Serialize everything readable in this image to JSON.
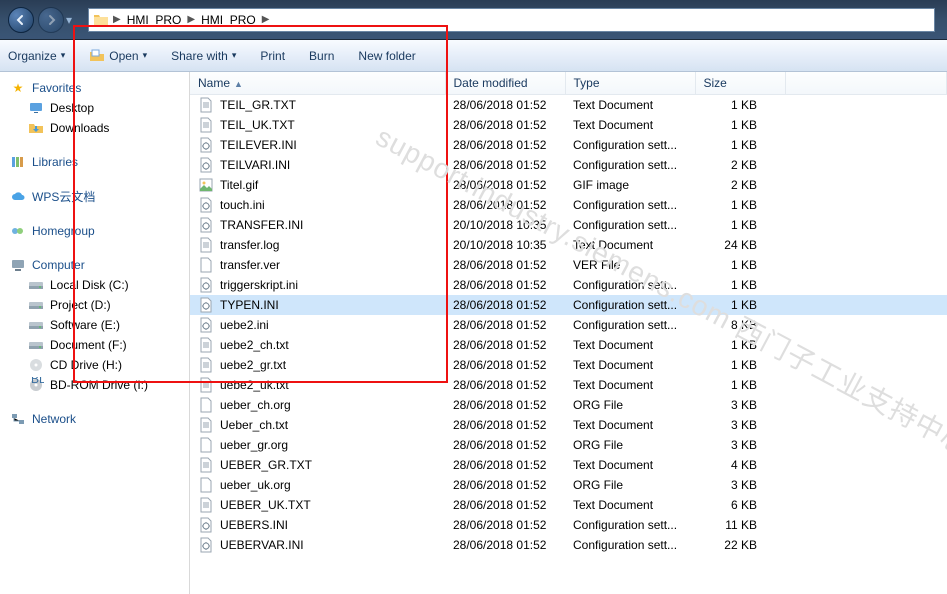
{
  "breadcrumbs": [
    "HMI_PRO",
    "HMI_PRO"
  ],
  "toolbar": {
    "organize": "Organize",
    "open": "Open",
    "share": "Share with",
    "print": "Print",
    "burn": "Burn",
    "newfolder": "New folder"
  },
  "sidebar": {
    "favorites": {
      "label": "Favorites",
      "items": [
        {
          "label": "Desktop",
          "icon": "desk"
        },
        {
          "label": "Downloads",
          "icon": "dl"
        }
      ]
    },
    "libraries": {
      "label": "Libraries"
    },
    "wps": {
      "label": "WPS云文档"
    },
    "homegroup": {
      "label": "Homegroup"
    },
    "computer": {
      "label": "Computer",
      "items": [
        {
          "label": "Local Disk (C:)",
          "icon": "hdd"
        },
        {
          "label": "Project (D:)",
          "icon": "hdd"
        },
        {
          "label": "Software (E:)",
          "icon": "hdd"
        },
        {
          "label": "Document (F:)",
          "icon": "hdd"
        },
        {
          "label": "CD Drive (H:)",
          "icon": "cd"
        },
        {
          "label": "BD-ROM Drive (I:)",
          "icon": "bd"
        }
      ]
    },
    "network": {
      "label": "Network"
    }
  },
  "columns": {
    "name": "Name",
    "date": "Date modified",
    "type": "Type",
    "size": "Size"
  },
  "selected": "TYPEN.INI",
  "files": [
    {
      "name": "TEIL_GR.TXT",
      "date": "28/06/2018 01:52",
      "type": "Text Document",
      "size": "1 KB",
      "icon": "txt"
    },
    {
      "name": "TEIL_UK.TXT",
      "date": "28/06/2018 01:52",
      "type": "Text Document",
      "size": "1 KB",
      "icon": "txt"
    },
    {
      "name": "TEILEVER.INI",
      "date": "28/06/2018 01:52",
      "type": "Configuration sett...",
      "size": "1 KB",
      "icon": "ini"
    },
    {
      "name": "TEILVARI.INI",
      "date": "28/06/2018 01:52",
      "type": "Configuration sett...",
      "size": "2 KB",
      "icon": "ini"
    },
    {
      "name": "Titel.gif",
      "date": "28/06/2018 01:52",
      "type": "GIF image",
      "size": "2 KB",
      "icon": "gif"
    },
    {
      "name": "touch.ini",
      "date": "28/06/2018 01:52",
      "type": "Configuration sett...",
      "size": "1 KB",
      "icon": "ini"
    },
    {
      "name": "TRANSFER.INI",
      "date": "20/10/2018 10:35",
      "type": "Configuration sett...",
      "size": "1 KB",
      "icon": "ini"
    },
    {
      "name": "transfer.log",
      "date": "20/10/2018 10:35",
      "type": "Text Document",
      "size": "24 KB",
      "icon": "txt"
    },
    {
      "name": "transfer.ver",
      "date": "28/06/2018 01:52",
      "type": "VER File",
      "size": "1 KB",
      "icon": "gen"
    },
    {
      "name": "triggerskript.ini",
      "date": "28/06/2018 01:52",
      "type": "Configuration sett...",
      "size": "1 KB",
      "icon": "ini"
    },
    {
      "name": "TYPEN.INI",
      "date": "28/06/2018 01:52",
      "type": "Configuration sett...",
      "size": "1 KB",
      "icon": "ini"
    },
    {
      "name": "uebe2.ini",
      "date": "28/06/2018 01:52",
      "type": "Configuration sett...",
      "size": "8 KB",
      "icon": "ini"
    },
    {
      "name": "uebe2_ch.txt",
      "date": "28/06/2018 01:52",
      "type": "Text Document",
      "size": "1 KB",
      "icon": "txt"
    },
    {
      "name": "uebe2_gr.txt",
      "date": "28/06/2018 01:52",
      "type": "Text Document",
      "size": "1 KB",
      "icon": "txt"
    },
    {
      "name": "uebe2_uk.txt",
      "date": "28/06/2018 01:52",
      "type": "Text Document",
      "size": "1 KB",
      "icon": "txt"
    },
    {
      "name": "ueber_ch.org",
      "date": "28/06/2018 01:52",
      "type": "ORG File",
      "size": "3 KB",
      "icon": "gen"
    },
    {
      "name": "Ueber_ch.txt",
      "date": "28/06/2018 01:52",
      "type": "Text Document",
      "size": "3 KB",
      "icon": "txt"
    },
    {
      "name": "ueber_gr.org",
      "date": "28/06/2018 01:52",
      "type": "ORG File",
      "size": "3 KB",
      "icon": "gen"
    },
    {
      "name": "UEBER_GR.TXT",
      "date": "28/06/2018 01:52",
      "type": "Text Document",
      "size": "4 KB",
      "icon": "txt"
    },
    {
      "name": "ueber_uk.org",
      "date": "28/06/2018 01:52",
      "type": "ORG File",
      "size": "3 KB",
      "icon": "gen"
    },
    {
      "name": "UEBER_UK.TXT",
      "date": "28/06/2018 01:52",
      "type": "Text Document",
      "size": "6 KB",
      "icon": "txt"
    },
    {
      "name": "UEBERS.INI",
      "date": "28/06/2018 01:52",
      "type": "Configuration sett...",
      "size": "11 KB",
      "icon": "ini"
    },
    {
      "name": "UEBERVAR.INI",
      "date": "28/06/2018 01:52",
      "type": "Configuration sett...",
      "size": "22 KB",
      "icon": "ini"
    }
  ],
  "watermark": "support.industry.siemens.com 西门子工业支持中心"
}
